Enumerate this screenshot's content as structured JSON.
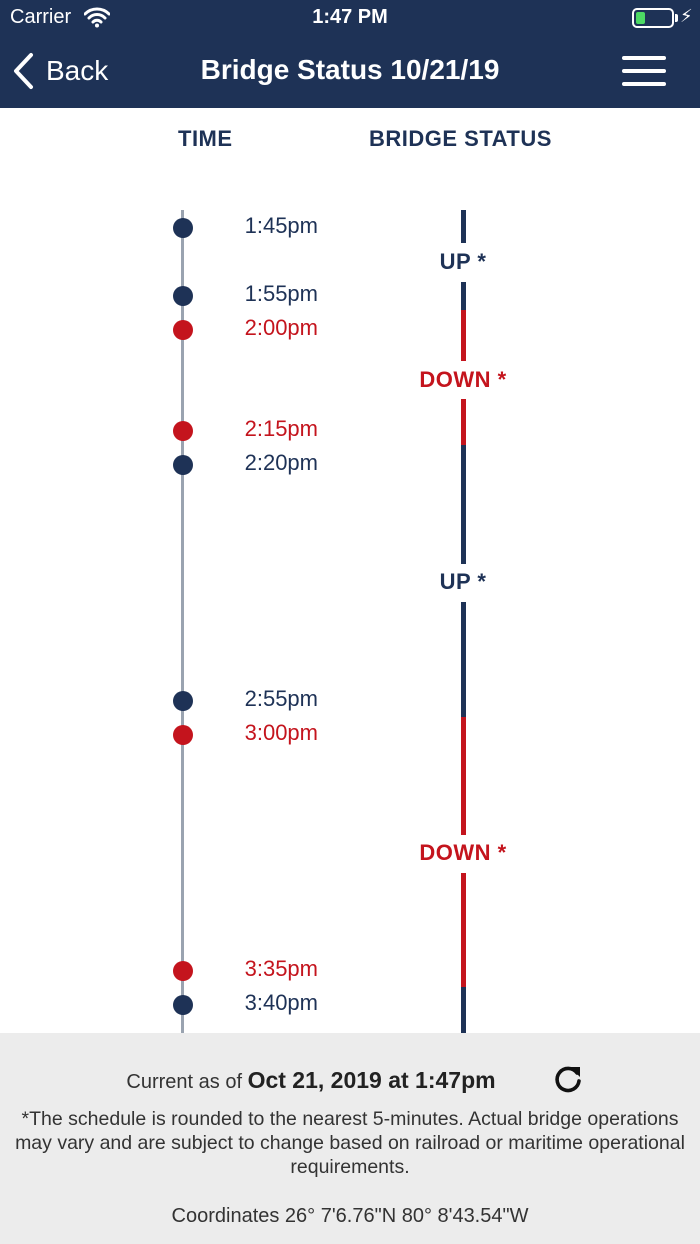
{
  "status_bar": {
    "carrier": "Carrier",
    "time": "1:47 PM",
    "battery_level": 0.25
  },
  "nav": {
    "back_label": "Back",
    "title": "Bridge Status 10/21/19"
  },
  "columns": {
    "time": "TIME",
    "status": "BRIDGE STATUS"
  },
  "times": [
    {
      "label": "1:45pm",
      "state": "up"
    },
    {
      "label": "1:55pm",
      "state": "up"
    },
    {
      "label": "2:00pm",
      "state": "down"
    },
    {
      "label": "2:15pm",
      "state": "down"
    },
    {
      "label": "2:20pm",
      "state": "up"
    },
    {
      "label": "2:55pm",
      "state": "up"
    },
    {
      "label": "3:00pm",
      "state": "down"
    },
    {
      "label": "3:35pm",
      "state": "down"
    },
    {
      "label": "3:40pm",
      "state": "up"
    }
  ],
  "statuses": [
    {
      "label": "UP *",
      "state": "up"
    },
    {
      "label": "DOWN *",
      "state": "down"
    },
    {
      "label": "UP *",
      "state": "up"
    },
    {
      "label": "DOWN *",
      "state": "down"
    }
  ],
  "colors": {
    "up": "#1e3256",
    "down": "#c4141d",
    "header": "#1e3256"
  },
  "footer": {
    "current_prefix": "Current as of",
    "current_value": "Oct 21, 2019 at 1:47pm",
    "disclaimer": "*The schedule is rounded to the nearest 5-minutes. Actual bridge operations may vary and are subject to change based on railroad or maritime operational requirements.",
    "coordinates": "Coordinates 26° 7'6.76\"N 80° 8'43.54\"W"
  }
}
